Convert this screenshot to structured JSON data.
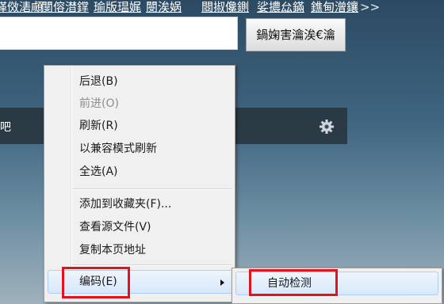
{
  "top_nav": {
    "links": [
      "缂傚湱顑",
      "閺傛澘鐣",
      "瑜版瑥娓",
      "閿涘娲",
      "閸掓儳鍘",
      "娑擃厽鏋",
      "鐎甸潧鑲"
    ],
    "more": ">>"
  },
  "search": {
    "button_label": "鍋婅害瀹涘€瀹"
  },
  "bar": {
    "text": "吧",
    "settings_icon": "gear-icon"
  },
  "context_menu": {
    "items": [
      {
        "label": "后退(B)",
        "enabled": true
      },
      {
        "label": "前进(O)",
        "enabled": false
      },
      {
        "label": "刷新(R)",
        "enabled": true
      },
      {
        "label": "以兼容模式刷新",
        "enabled": true
      },
      {
        "label": "全选(A)",
        "enabled": true
      },
      {
        "label": "添加到收藏夹(F)...",
        "enabled": true
      },
      {
        "label": "查看源文件(V)",
        "enabled": true
      },
      {
        "label": "复制本页地址",
        "enabled": true
      },
      {
        "label": "编码(E)",
        "enabled": true,
        "has_submenu": true,
        "highlighted": true
      }
    ]
  },
  "submenu": {
    "items": [
      {
        "label": "自动检测",
        "highlighted": true
      }
    ]
  },
  "colors": {
    "annotation_red": "#e0141c",
    "highlight_blue": "#d8e8fa"
  }
}
